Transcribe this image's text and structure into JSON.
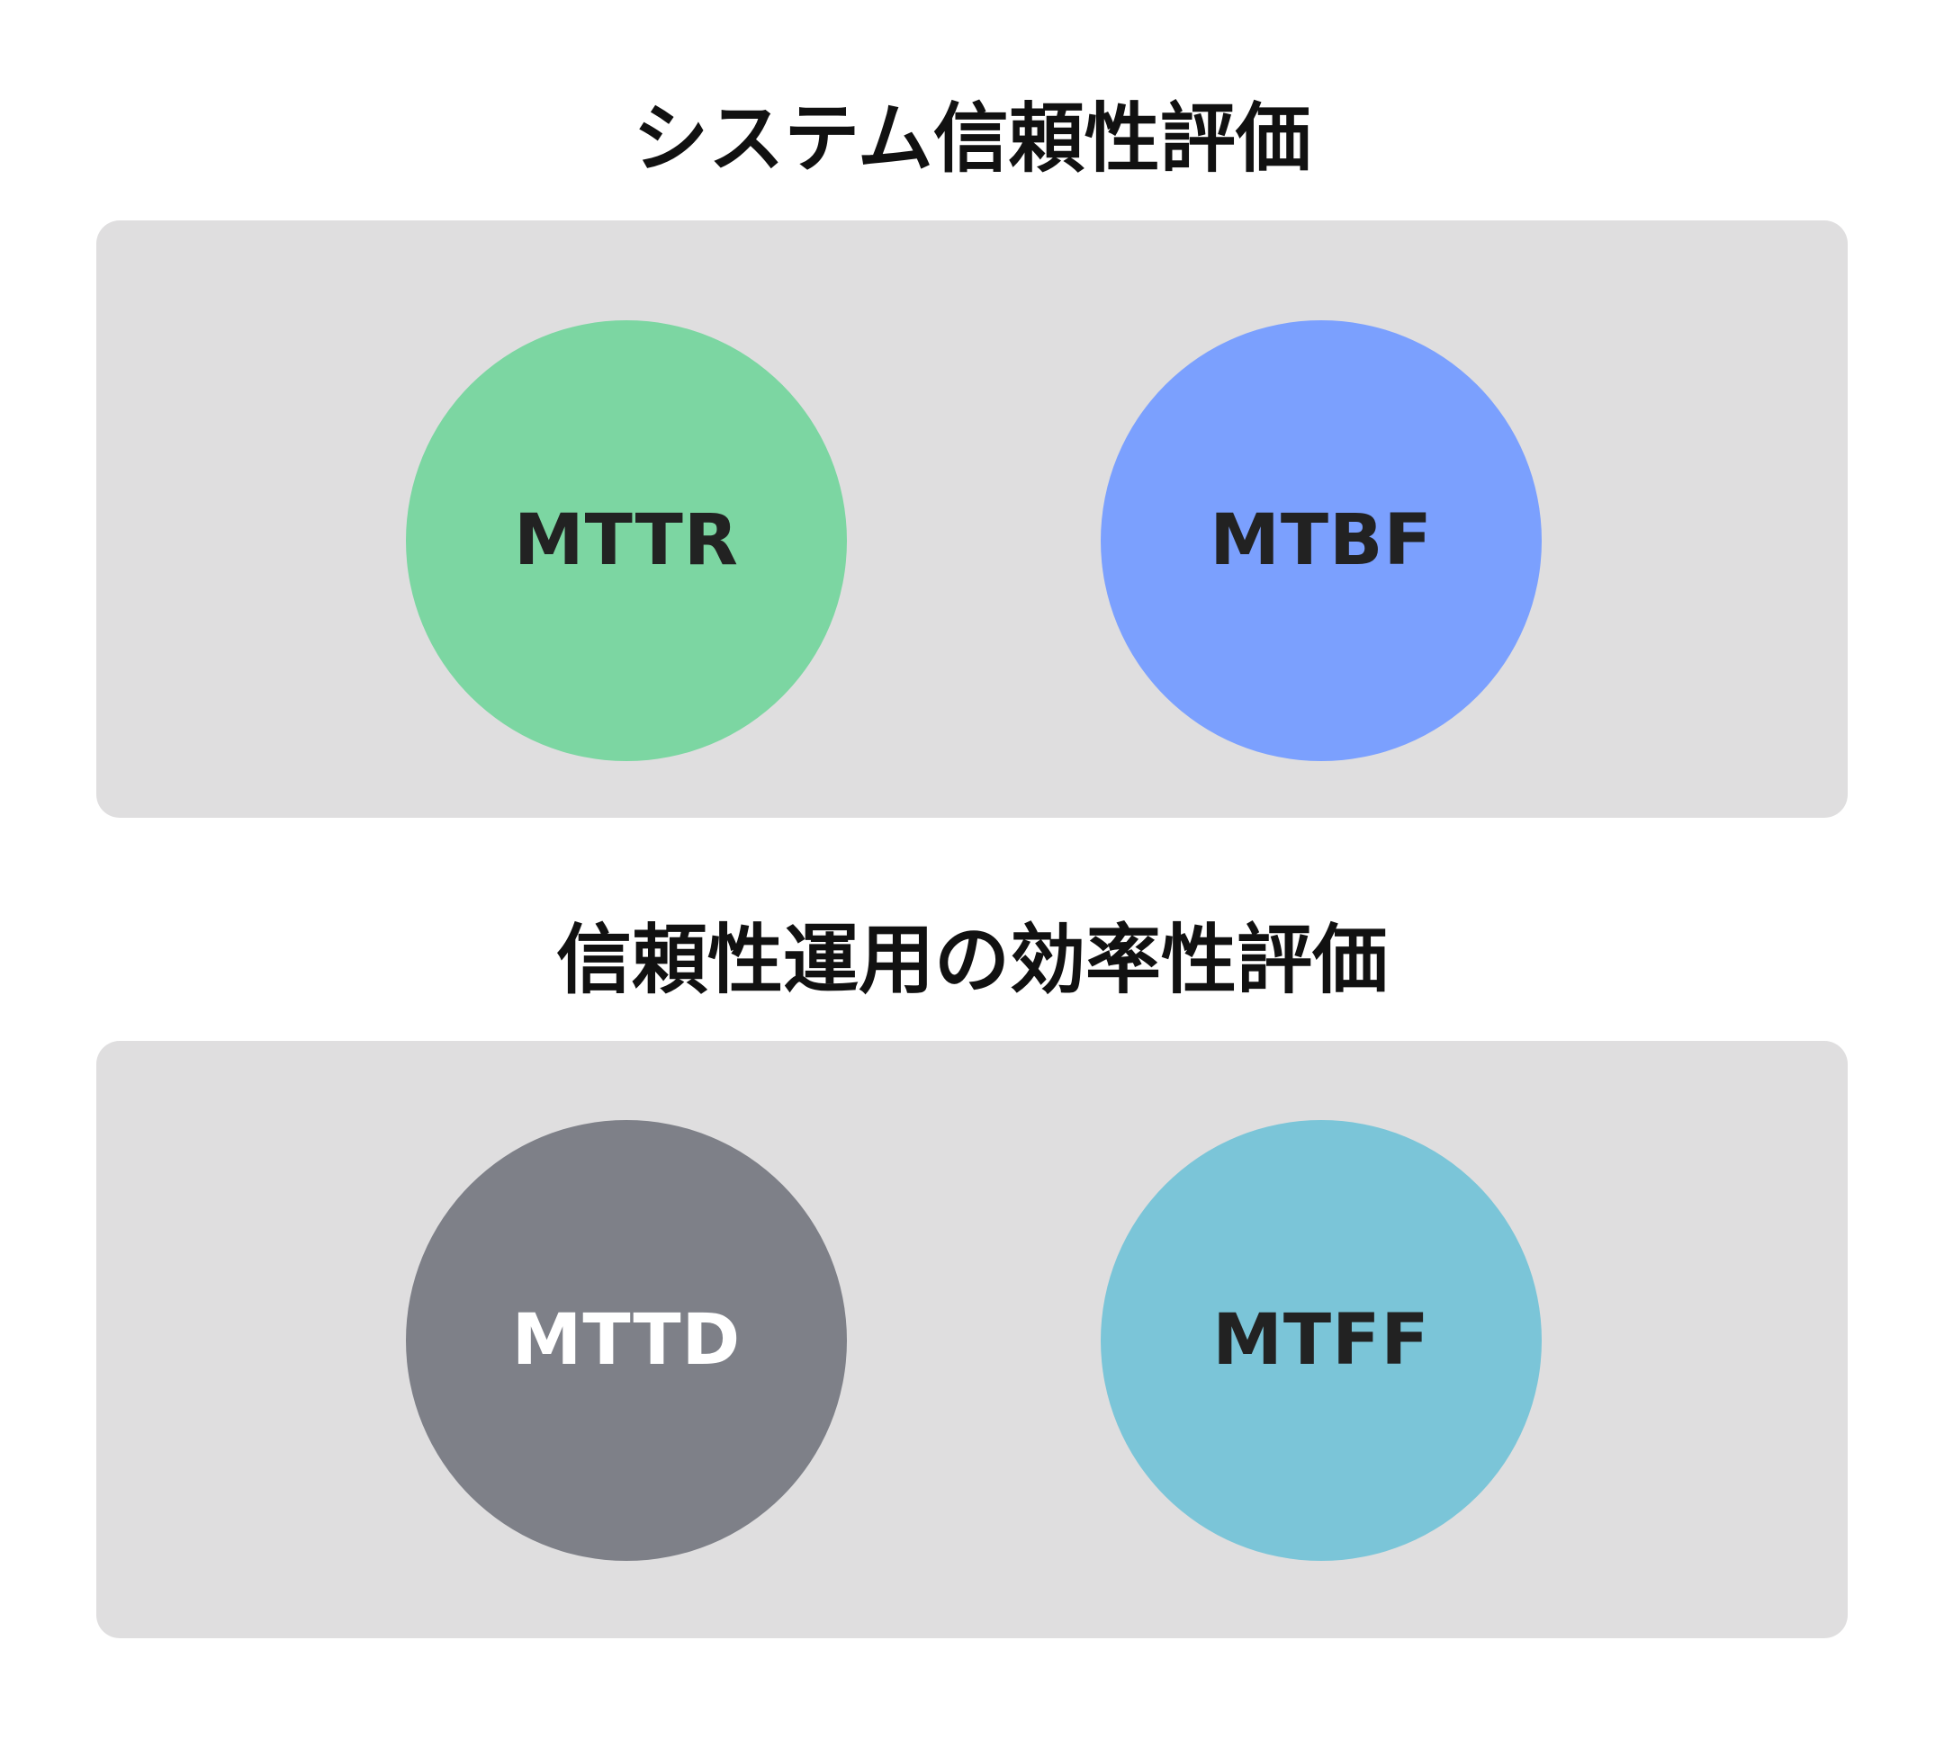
{
  "sections": [
    {
      "title": "システム信頼性評価",
      "metrics": [
        {
          "label": "MTTR",
          "color": "#7cd6a2",
          "text_color": "#222222"
        },
        {
          "label": "MTBF",
          "color": "#7ba0fe",
          "text_color": "#222222"
        }
      ]
    },
    {
      "title": "信頼性運用の効率性評価",
      "metrics": [
        {
          "label": "MTTD",
          "color": "#7e8088",
          "text_color": "#ffffff"
        },
        {
          "label": "MTFF",
          "color": "#7bc5d8",
          "text_color": "#222222"
        }
      ]
    }
  ],
  "colors": {
    "panel_background": "#dfdedf",
    "title_text": "#111111"
  }
}
